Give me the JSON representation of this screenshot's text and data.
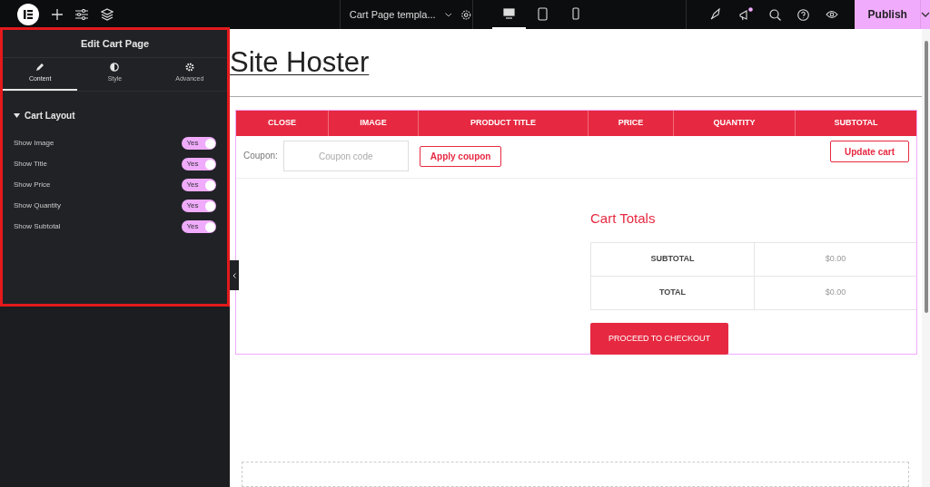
{
  "topbar": {
    "document_title": "Cart Page templa...",
    "devices": [
      {
        "kind": "desktop",
        "selected": true
      },
      {
        "kind": "tablet",
        "selected": false
      },
      {
        "kind": "mobile",
        "selected": false
      }
    ],
    "notification": true,
    "publish": "Publish"
  },
  "panel": {
    "title": "Edit Cart Page",
    "tabs": [
      {
        "kind": "content",
        "label": "Content",
        "selected": true
      },
      {
        "kind": "style",
        "label": "Style",
        "selected": false
      },
      {
        "kind": "advanced",
        "label": "Advanced",
        "selected": false
      }
    ],
    "section": {
      "title": "Cart Layout",
      "expanded": true
    },
    "switches": [
      {
        "label": "Show Image",
        "on": true,
        "text": "Yes"
      },
      {
        "label": "Show Title",
        "on": true,
        "text": "Yes"
      },
      {
        "label": "Show Price",
        "on": true,
        "text": "Yes"
      },
      {
        "label": "Show Quantity",
        "on": true,
        "text": "Yes"
      },
      {
        "label": "Show Subtotal",
        "on": true,
        "text": "Yes"
      }
    ]
  },
  "canvas": {
    "site_title": "Site Hoster",
    "table": {
      "columns": [
        "CLOSE",
        "IMAGE",
        "PRODUCT TITLE",
        "PRICE",
        "QUANTITY",
        "SUBTOTAL"
      ]
    },
    "coupon": {
      "label": "Coupon:",
      "placeholder": "Coupon code",
      "apply": "Apply coupon",
      "update": "Update cart"
    },
    "totals": {
      "title": "Cart Totals",
      "rows": [
        {
          "label": "SUBTOTAL",
          "value": "$0.00"
        },
        {
          "label": "TOTAL",
          "value": "$0.00"
        }
      ],
      "checkout": "PROCEED TO CHECKOUT"
    }
  }
}
